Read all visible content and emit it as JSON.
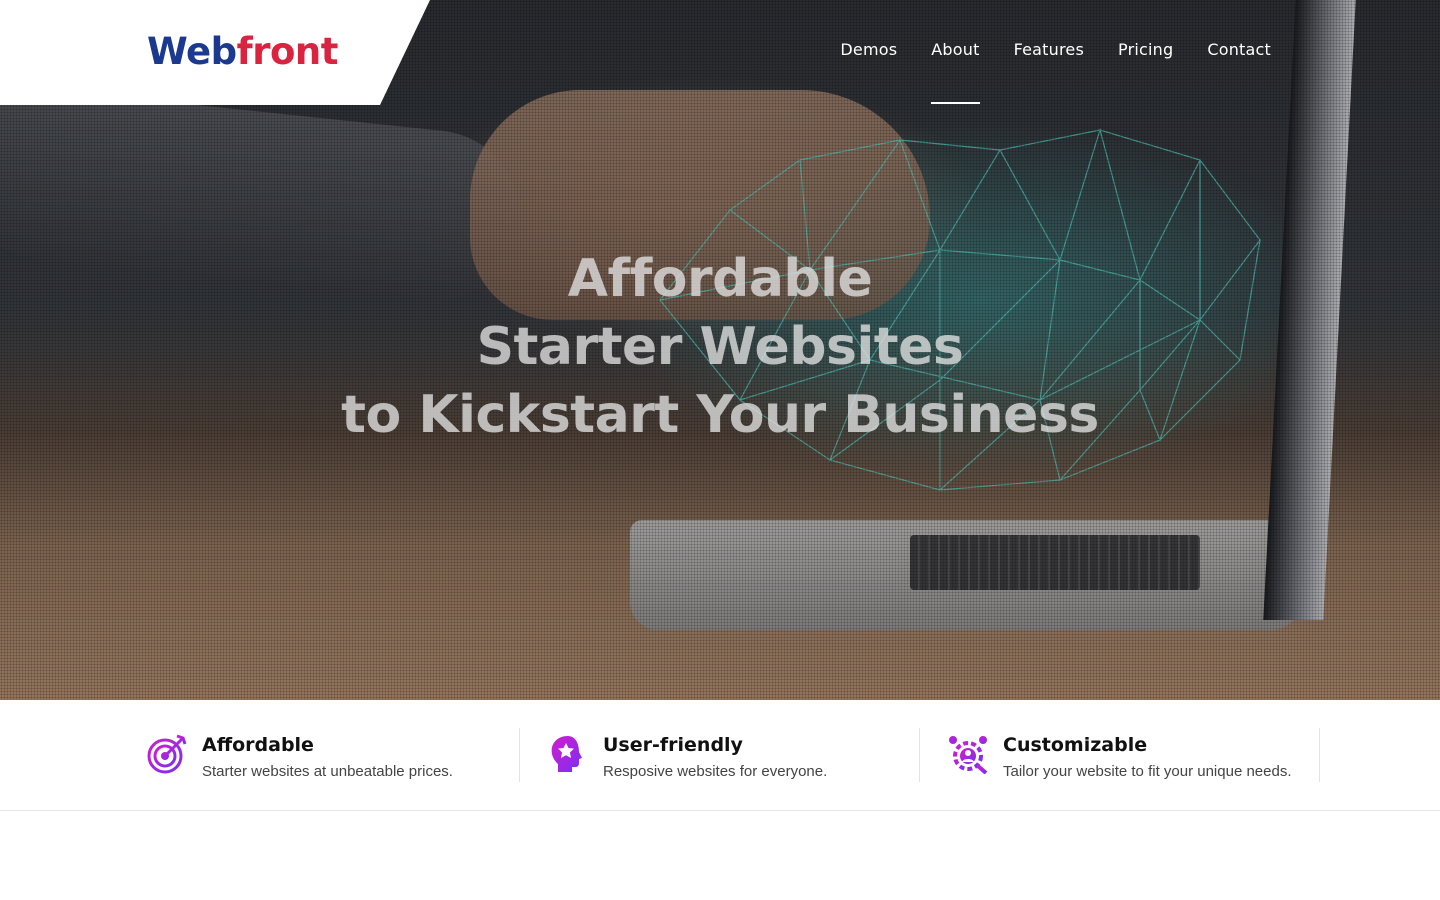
{
  "brand": {
    "logo_part1": "W",
    "logo_part2": "eb",
    "logo_part3": "front"
  },
  "nav": {
    "items": [
      "Demos",
      "About",
      "Features",
      "Pricing",
      "Contact"
    ],
    "active": "About"
  },
  "hero": {
    "line1": "Affordable",
    "line2": "Starter Websites",
    "line3": "to Kickstart Your Business"
  },
  "features": [
    {
      "icon": "target-icon",
      "title": "Affordable",
      "description": "Starter websites at unbeatable prices."
    },
    {
      "icon": "user-star-icon",
      "title": "User-friendly",
      "description": "Resposive websites for everyone."
    },
    {
      "icon": "settings-person-icon",
      "title": "Customizable",
      "description": "Tailor your website to fit your unique needs."
    }
  ],
  "colors": {
    "brand_blue": "#1b3a8f",
    "brand_red": "#d9233f",
    "icon_gradient_start": "#c21fd6",
    "icon_gradient_end": "#7a2ff0"
  }
}
